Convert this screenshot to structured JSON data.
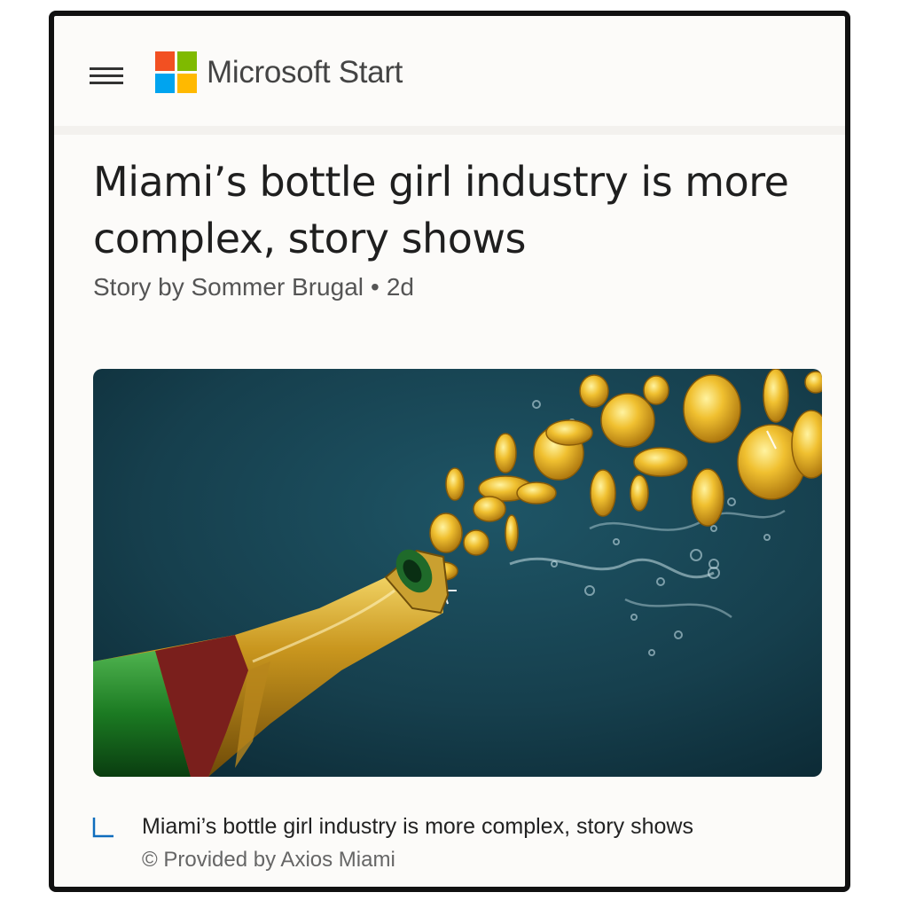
{
  "header": {
    "brand": "Microsoft Start",
    "logo_colors": [
      "#f25022",
      "#7fba00",
      "#00a4ef",
      "#ffb900"
    ],
    "menu_icon": "hamburger-menu-icon"
  },
  "article": {
    "title": "Miami’s bottle girl industry is more complex, story shows",
    "byline": {
      "author": "Story by Sommer Brugal",
      "separator": "•",
      "age": "2d"
    },
    "image": {
      "subject": "champagne bottle spraying gold coins"
    },
    "caption": {
      "text": "Miami’s bottle girl industry is more complex, story shows",
      "credit": "© Provided by Axios Miami",
      "icon": "caption-corner-icon"
    }
  },
  "colors": {
    "accent": "#0f6cbd",
    "image_background": "#153e4b"
  }
}
